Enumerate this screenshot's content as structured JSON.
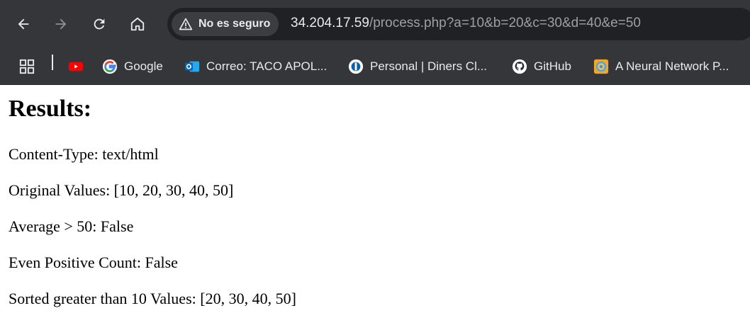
{
  "browser": {
    "security_label": "No es seguro",
    "url_host": "34.204.17.59",
    "url_path": "/process.php?a=10&b=20&c=30&d=40&e=50"
  },
  "bookmarks": [
    {
      "label": "",
      "icon": "youtube-icon"
    },
    {
      "label": "Google",
      "icon": "google-icon"
    },
    {
      "label": "Correo: TACO APOL...",
      "icon": "outlook-icon"
    },
    {
      "label": "Personal | Diners Cl...",
      "icon": "diners-icon"
    },
    {
      "label": "GitHub",
      "icon": "github-icon"
    },
    {
      "label": "A Neural Network P...",
      "icon": "playground-icon"
    }
  ],
  "page": {
    "heading": "Results:",
    "lines": [
      "Content-Type: text/html",
      "Original Values: [10, 20, 30, 40, 50]",
      "Average > 50: False",
      "Even Positive Count: False",
      "Sorted greater than 10 Values: [20, 30, 40, 50]"
    ]
  },
  "colors": {
    "chrome_bg": "#35363a",
    "omnibox_bg": "#202124",
    "text_light": "#e8eaed",
    "text_dim": "#9aa0a6"
  }
}
